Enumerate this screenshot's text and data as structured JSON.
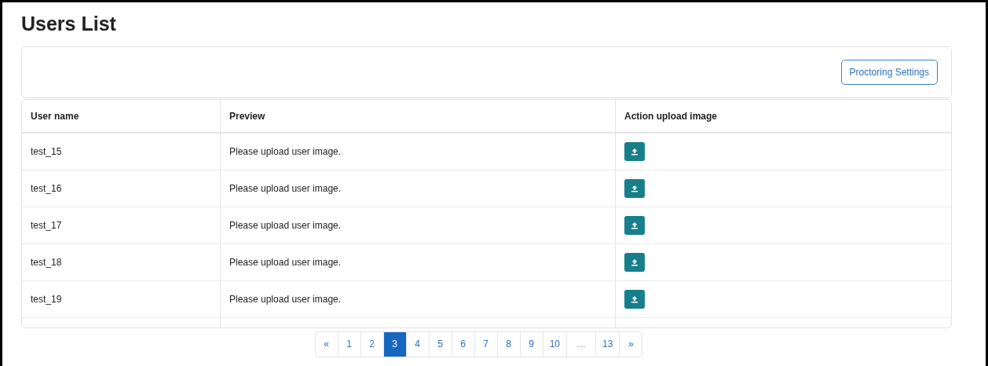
{
  "title": "Users List",
  "toolbar": {
    "button": "Proctoring Settings"
  },
  "table": {
    "columns": [
      "User name",
      "Preview",
      "Action upload image"
    ],
    "rows": [
      {
        "user": "test_15",
        "preview": "Please upload user image."
      },
      {
        "user": "test_16",
        "preview": "Please upload user image."
      },
      {
        "user": "test_17",
        "preview": "Please upload user image."
      },
      {
        "user": "test_18",
        "preview": "Please upload user image."
      },
      {
        "user": "test_19",
        "preview": "Please upload user image."
      }
    ]
  },
  "pagination": [
    {
      "label": "«",
      "selected": false,
      "disabled": false
    },
    {
      "label": "1",
      "selected": false,
      "disabled": false
    },
    {
      "label": "2",
      "selected": false,
      "disabled": false
    },
    {
      "label": "3",
      "selected": true,
      "disabled": false
    },
    {
      "label": "4",
      "selected": false,
      "disabled": false
    },
    {
      "label": "5",
      "selected": false,
      "disabled": false
    },
    {
      "label": "6",
      "selected": false,
      "disabled": false
    },
    {
      "label": "7",
      "selected": false,
      "disabled": false
    },
    {
      "label": "8",
      "selected": false,
      "disabled": false
    },
    {
      "label": "9",
      "selected": false,
      "disabled": false
    },
    {
      "label": "10",
      "selected": false,
      "disabled": false
    },
    {
      "label": "…",
      "selected": false,
      "disabled": true
    },
    {
      "label": "13",
      "selected": false,
      "disabled": false
    },
    {
      "label": "»",
      "selected": false,
      "disabled": false
    }
  ]
}
